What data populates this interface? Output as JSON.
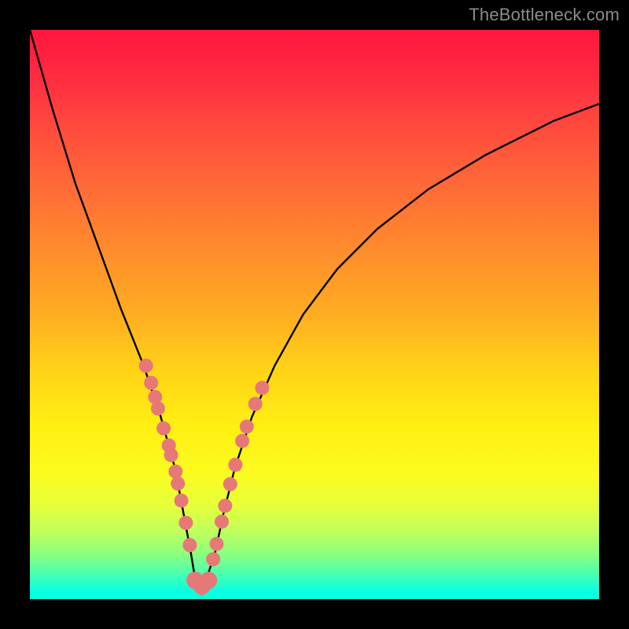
{
  "watermark": "TheBottleneck.com",
  "colors": {
    "dot_fill": "#e77878",
    "dot_stroke": "#cf5a5a",
    "curve_stroke": "#000000"
  },
  "chart_data": {
    "type": "line",
    "title": "",
    "xlabel": "",
    "ylabel": "",
    "xlim": [
      0,
      100
    ],
    "ylim": [
      0,
      100
    ],
    "series": [
      {
        "name": "bottleneck-curve",
        "x": [
          0,
          4,
          8,
          12,
          16,
          20,
          23,
          25.5,
          27,
          28.3,
          29.3,
          30.5,
          32.5,
          34,
          36,
          39,
          43,
          48,
          54,
          61,
          70,
          80,
          92,
          100
        ],
        "y": [
          100,
          86,
          73,
          62,
          51,
          41,
          32,
          23,
          15,
          8,
          2,
          2,
          8,
          15,
          23,
          32,
          41,
          50,
          58,
          65,
          72,
          78,
          84,
          87
        ]
      }
    ],
    "dots_left": [
      {
        "x": 20.4,
        "y": 41
      },
      {
        "x": 21.3,
        "y": 38
      },
      {
        "x": 22.0,
        "y": 35.5
      },
      {
        "x": 22.5,
        "y": 33.5
      },
      {
        "x": 23.5,
        "y": 30
      },
      {
        "x": 24.4,
        "y": 27
      },
      {
        "x": 24.8,
        "y": 25.3
      },
      {
        "x": 25.6,
        "y": 22.4
      },
      {
        "x": 26.0,
        "y": 20.3
      },
      {
        "x": 26.6,
        "y": 17.3
      },
      {
        "x": 27.4,
        "y": 13.4
      },
      {
        "x": 28.1,
        "y": 9.5
      }
    ],
    "dots_right": [
      {
        "x": 32.2,
        "y": 7.0
      },
      {
        "x": 32.8,
        "y": 9.7
      },
      {
        "x": 33.7,
        "y": 13.6
      },
      {
        "x": 34.3,
        "y": 16.4
      },
      {
        "x": 35.2,
        "y": 20.2
      },
      {
        "x": 36.1,
        "y": 23.6
      },
      {
        "x": 37.3,
        "y": 27.8
      },
      {
        "x": 38.1,
        "y": 30.3
      },
      {
        "x": 39.6,
        "y": 34.3
      },
      {
        "x": 40.8,
        "y": 37.1
      }
    ],
    "dots_bottom": [
      {
        "x": 29.0,
        "y": 3.3
      },
      {
        "x": 30.2,
        "y": 2.3
      },
      {
        "x": 31.4,
        "y": 3.3
      }
    ]
  }
}
